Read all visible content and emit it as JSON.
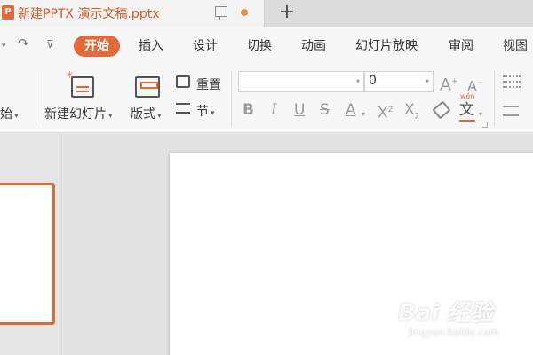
{
  "document": {
    "title": "新建PPTX 演示文稿.pptx",
    "app_icon_glyph": "P"
  },
  "tabbar": {
    "new_tab": "+"
  },
  "quick_access": {
    "more_caret": "▾",
    "redo": "↷",
    "customize": "⊽"
  },
  "ribbon_tabs": [
    {
      "label": "开始",
      "active": true
    },
    {
      "label": "插入"
    },
    {
      "label": "设计"
    },
    {
      "label": "切换"
    },
    {
      "label": "动画"
    },
    {
      "label": "幻灯片放映"
    },
    {
      "label": "审阅"
    },
    {
      "label": "视图"
    }
  ],
  "ribbon": {
    "start_partial": "始",
    "new_slide": "新建幻灯片",
    "layout": "版式",
    "reset": "重置",
    "section": "节",
    "font_name": "",
    "font_size": "0",
    "grow_font": "A",
    "shrink_font": "A",
    "bold": "B",
    "italic": "I",
    "underline": "U",
    "strikethrough": "S",
    "font_color": "A",
    "superscript": "X",
    "subscript": "X",
    "phonetic": "文",
    "phonetic_small": "wén",
    "caret": "▾"
  },
  "watermark": {
    "brand": "Bai 经验",
    "url": "jingyan.baidu.com"
  },
  "colors": {
    "accent": "#e2693a",
    "tab_bg": "#dcdcdc",
    "ribbon_bg": "#f7f7f7"
  }
}
